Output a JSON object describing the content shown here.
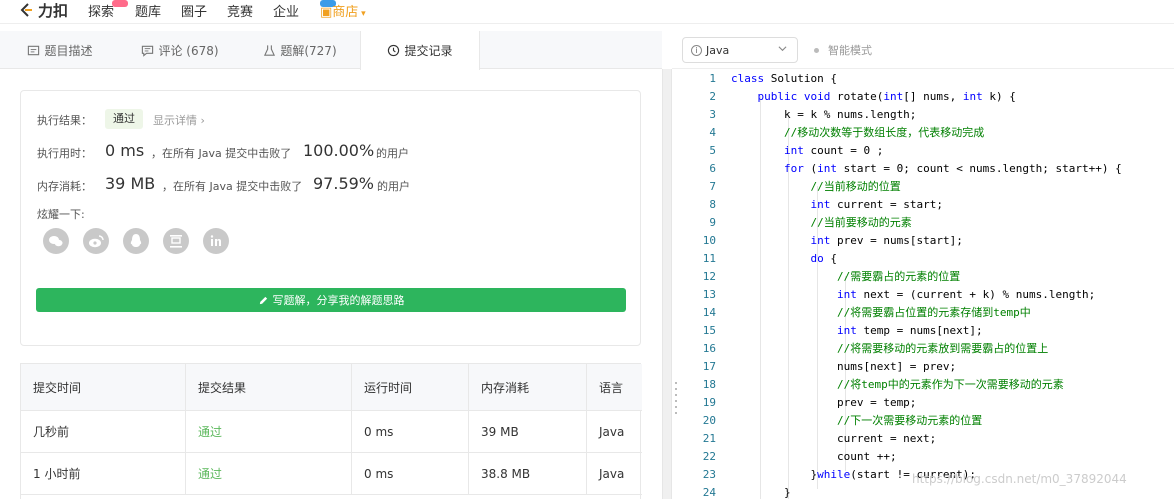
{
  "topnav": {
    "logo": "力扣",
    "items": [
      "探索",
      "题库",
      "圈子",
      "竞赛",
      "企业"
    ],
    "shop": "商店"
  },
  "tabs": [
    {
      "label": "题目描述",
      "icon": "document-icon"
    },
    {
      "label": "评论 (678)",
      "icon": "comment-icon"
    },
    {
      "label": "题解(727)",
      "icon": "flask-icon"
    },
    {
      "label": "提交记录",
      "icon": "clock-icon"
    }
  ],
  "editor_bar": {
    "language": "Java",
    "smart_mode": "智能模式"
  },
  "result": {
    "exec_result_label": "执行结果：",
    "exec_result_value": "通过",
    "show_detail": "显示详情 ›",
    "time_label": "执行用时：",
    "time_value": "0 ms",
    "time_text": "，在所有 Java 提交中击败了",
    "time_percent": "100.00%",
    "time_suffix": "的用户",
    "memory_label": "内存消耗：",
    "memory_value": "39 MB",
    "memory_text": "，在所有 Java 提交中击败了",
    "memory_percent": "97.59%",
    "memory_suffix": "的用户",
    "share_label": "炫耀一下:",
    "share_icons": [
      "wechat-icon",
      "weibo-icon",
      "qq-icon",
      "douban-icon",
      "linkedin-icon"
    ],
    "write_button": "写题解，分享我的解题思路"
  },
  "submissions": {
    "headers": [
      "提交时间",
      "提交结果",
      "运行时间",
      "内存消耗",
      "语言"
    ],
    "rows": [
      [
        "几秒前",
        "通过",
        "0 ms",
        "39 MB",
        "Java"
      ],
      [
        "1 小时前",
        "通过",
        "0 ms",
        "38.8 MB",
        "Java"
      ]
    ]
  },
  "code": [
    {
      "n": "1",
      "t": "class Solution {"
    },
    {
      "n": "2",
      "t": "    public void rotate(int[] nums, int k) {"
    },
    {
      "n": "3",
      "t": "        k = k % nums.length;"
    },
    {
      "n": "4",
      "t": "        //移动次数等于数组长度，代表移动完成"
    },
    {
      "n": "5",
      "t": "        int count = 0 ;"
    },
    {
      "n": "6",
      "t": "        for (int start = 0; count < nums.length; start++) {"
    },
    {
      "n": "7",
      "t": "            //当前移动的位置"
    },
    {
      "n": "8",
      "t": "            int current = start;"
    },
    {
      "n": "9",
      "t": "            //当前要移动的元素"
    },
    {
      "n": "10",
      "t": "            int prev = nums[start];"
    },
    {
      "n": "11",
      "t": "            do {"
    },
    {
      "n": "12",
      "t": "                //需要霸占的元素的位置"
    },
    {
      "n": "13",
      "t": "                int next = (current + k) % nums.length;"
    },
    {
      "n": "14",
      "t": "                //将需要霸占位置的元素存储到temp中"
    },
    {
      "n": "15",
      "t": "                int temp = nums[next];"
    },
    {
      "n": "16",
      "t": "                //将需要移动的元素放到需要霸占的位置上"
    },
    {
      "n": "17",
      "t": "                nums[next] = prev;"
    },
    {
      "n": "18",
      "t": "                //将temp中的元素作为下一次需要移动的元素"
    },
    {
      "n": "19",
      "t": "                prev = temp;"
    },
    {
      "n": "20",
      "t": "                //下一次需要移动元素的位置"
    },
    {
      "n": "21",
      "t": "                current = next;"
    },
    {
      "n": "22",
      "t": "                count ++;"
    },
    {
      "n": "23",
      "t": "            }while(start != current);"
    },
    {
      "n": "24",
      "t": "        }"
    }
  ],
  "watermark": "https://blog.csdn.net/m0_37892044",
  "colors": {
    "accent_green": "#2db55d",
    "pass_green": "#5cb85c",
    "keyword_blue": "#0000ff",
    "comment_green": "#008000"
  }
}
